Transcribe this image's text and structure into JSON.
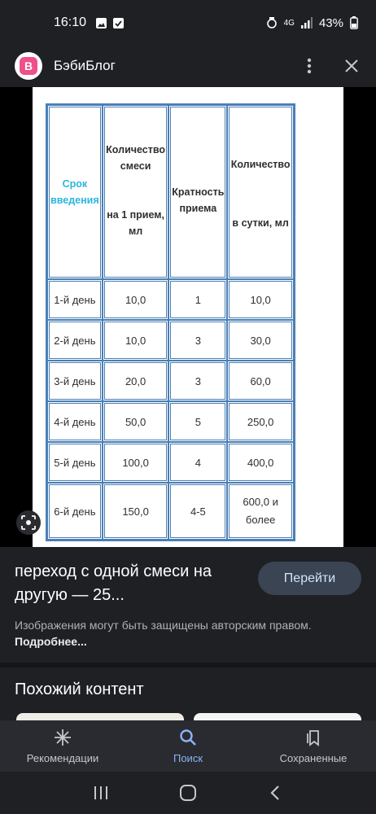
{
  "status_bar": {
    "time": "16:10",
    "network": "4G",
    "battery": "43%"
  },
  "app": {
    "logo_letter": "B",
    "title": "БэбиБлог"
  },
  "table": {
    "headers": {
      "col1": "Срок введения",
      "col2_top": "Количество смеси",
      "col2_bottom": "на 1 прием, мл",
      "col3": "Кратность приема",
      "col4_top": "Количество",
      "col4_bottom": "в сутки, мл"
    },
    "rows": [
      {
        "day": "1-й день",
        "amount": "10,0",
        "freq": "1",
        "daily": "10,0"
      },
      {
        "day": "2-й день",
        "amount": "10,0",
        "freq": "3",
        "daily": "30,0"
      },
      {
        "day": "3-й день",
        "amount": "20,0",
        "freq": "3",
        "daily": "60,0"
      },
      {
        "day": "4-й день",
        "amount": "50,0",
        "freq": "5",
        "daily": "250,0"
      },
      {
        "day": "5-й день",
        "amount": "100,0",
        "freq": "4",
        "daily": "400,0"
      },
      {
        "day": "6-й день",
        "amount": "150,0",
        "freq": "4-5",
        "daily": "600,0 и более"
      }
    ]
  },
  "result": {
    "title": "переход с одной смеси на другую — 25...",
    "button": "Перейти",
    "copyright": "Изображения могут быть защищены авторским правом.",
    "more": "Подробнее..."
  },
  "similar": {
    "title": "Похожий контент"
  },
  "nav": {
    "items": [
      {
        "label": "Рекомендации",
        "icon": "sparkle-icon"
      },
      {
        "label": "Поиск",
        "icon": "search-icon"
      },
      {
        "label": "Сохраненные",
        "icon": "bookmarks-icon"
      }
    ]
  },
  "colors": {
    "accent": "#8ab4f8",
    "table_border": "#4a7fb5",
    "header_accent": "#2bb6de",
    "logo": "#ef4f8b"
  }
}
